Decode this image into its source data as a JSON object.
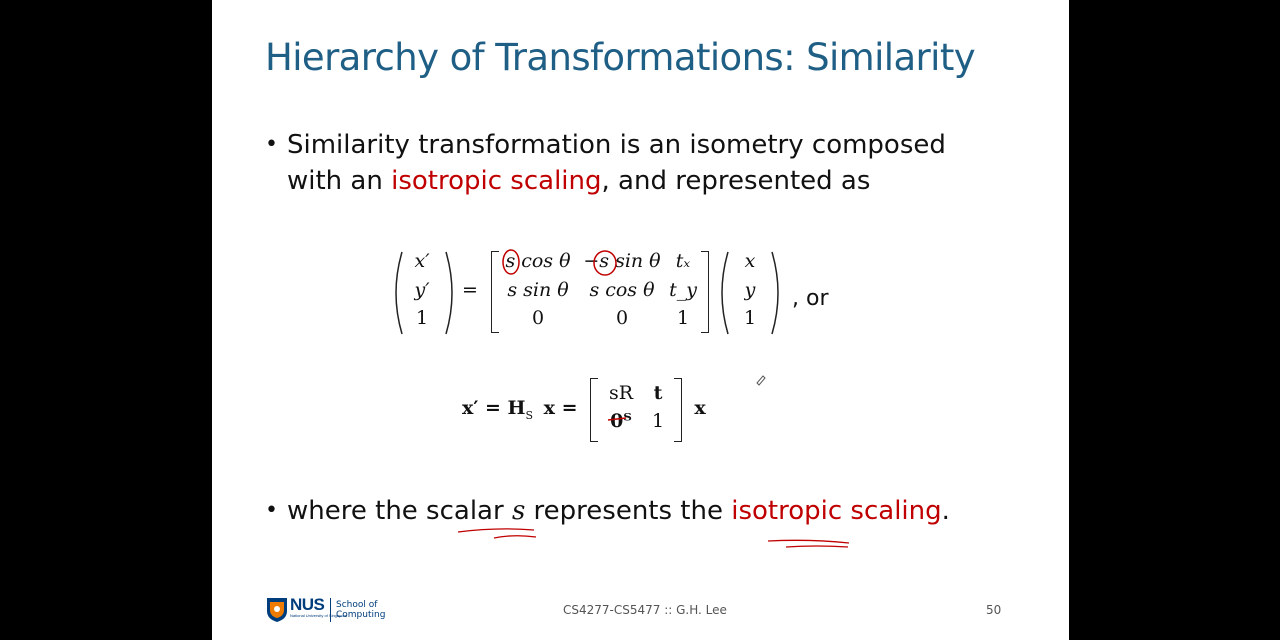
{
  "slide": {
    "title": "Hierarchy of Transformations: Similarity",
    "bullet1": {
      "line1": "Similarity transformation is an isometry composed",
      "line2_pre": "with an ",
      "line2_red": "isotropic scaling",
      "line2_post": ", and represented as"
    },
    "equation1": {
      "lhs": [
        "x′",
        "y′",
        "1"
      ],
      "eq": "=",
      "matrix": [
        [
          "s cos θ",
          "−s sin θ",
          "tₓ"
        ],
        [
          "s sin θ",
          "s cos θ",
          "t_y"
        ],
        [
          "0",
          "0",
          "1"
        ]
      ],
      "rhs": [
        "x",
        "y",
        "1"
      ],
      "suffix": ", or"
    },
    "equation2": {
      "lhs": "x′ = H",
      "sub": "S",
      "mid": "x =",
      "matrix": [
        [
          "sR",
          "t"
        ],
        [
          "0ᵀ",
          "1"
        ]
      ],
      "rhs": "x"
    },
    "bullet2": {
      "pre": "where the scalar ",
      "var": "s",
      "mid": " represents the ",
      "red": "isotropic scaling",
      "post": "."
    },
    "footer": {
      "logo_text": "NUS",
      "logo_sub": "National University of Singapore",
      "school_line1": "School of",
      "school_line2": "Computing",
      "course": "CS4277-CS5477 :: G.H. Lee",
      "page": "50"
    },
    "colors": {
      "title": "#1f5f85",
      "accent_red": "#c00000",
      "nus_blue": "#003d7c",
      "nus_orange": "#ef7c00"
    }
  }
}
